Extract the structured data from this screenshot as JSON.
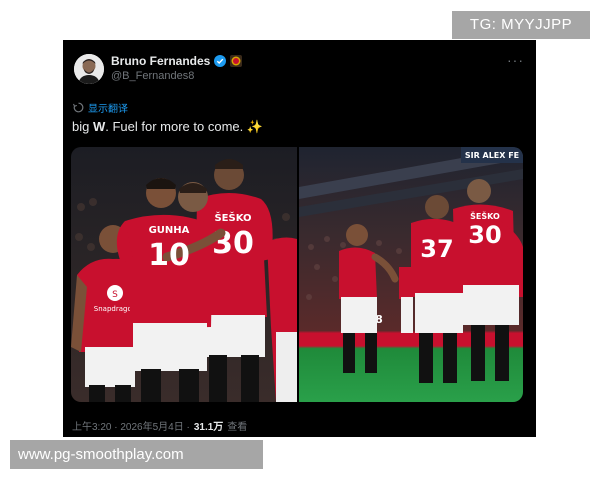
{
  "watermarks": {
    "top": "TG: MYYJJPP",
    "bottom": "www.pg-smoothplay.com"
  },
  "post": {
    "author_name": "Bruno Fernandes",
    "author_handle": "@B_Fernandes8",
    "translate_label": "显示翻译",
    "text_prefix": "big ",
    "text_bold": "W",
    "text_suffix": ". Fuel for more to come. ✨",
    "timestamp": "上午3:20 · 2026年5月4日 ·",
    "views_count": "31.1万",
    "views_label": "查看"
  },
  "media": {
    "left_photo": {
      "jerseys": [
        "10",
        "30",
        "GUNHA",
        "ŠEŠKO"
      ],
      "sponsor": "Snapdragon"
    },
    "right_photo": {
      "jerseys": [
        "8",
        "37",
        "30",
        "ŠEŠKO"
      ],
      "stand_sign": "SIR ALEX FE"
    }
  },
  "colors": {
    "background": "#000000",
    "text": "#e7e9ea",
    "secondary": "#71767b",
    "link": "#1d9bf0",
    "kit_red": "#c8102e"
  },
  "icons": [
    "verified-icon",
    "club-badge-icon",
    "more-icon",
    "translate-icon",
    "sparkles-icon"
  ]
}
